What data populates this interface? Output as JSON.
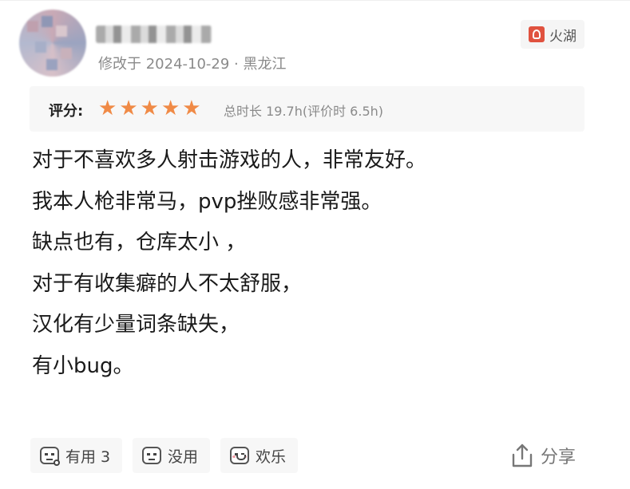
{
  "header": {
    "meta": "修改于 2024-10-29 · 黑龙江",
    "platform_badge": "火湖"
  },
  "rating": {
    "label": "评分:",
    "stars": 5,
    "star_glyph": "★",
    "star_color": "#f08a46",
    "playtime": "总时长 19.7h(评价时 6.5h)"
  },
  "review": {
    "lines": [
      "对于不喜欢多人射击游戏的人，非常友好。",
      "我本人枪非常马，pvp挫败感非常强。",
      "缺点也有，仓库太小 ，",
      "对于有收集癖的人不太舒服，",
      "汉化有少量词条缺失，",
      "有小bug。"
    ]
  },
  "footer": {
    "useful_label": "有用 3",
    "useless_label": "没用",
    "funny_label": "欢乐",
    "share_label": "分享"
  },
  "icons": {
    "platform": "fire-icon",
    "useful": "laugh-face-icon",
    "useless": "neutral-face-icon",
    "funny": "smile-face-icon",
    "share": "share-icon"
  }
}
